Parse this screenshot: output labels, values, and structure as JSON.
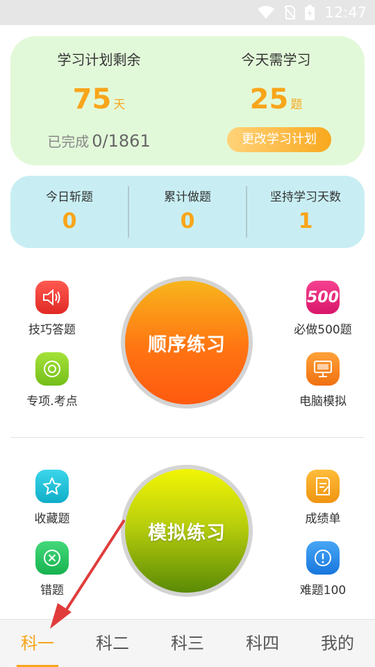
{
  "status_bar": {
    "time": "12:47",
    "icons": [
      "wifi-icon",
      "no-sim-icon",
      "battery-icon"
    ]
  },
  "plan": {
    "left_title": "学习计划剩余",
    "days_value": "75",
    "days_unit": "天",
    "completed_label": "已完成",
    "completed_value": "0/1861",
    "right_title": "今天需学习",
    "questions_value": "25",
    "questions_unit": "题",
    "change_button": "更改学习计划"
  },
  "stats": [
    {
      "label": "今日斩题",
      "value": "0"
    },
    {
      "label": "累计做题",
      "value": "0"
    },
    {
      "label": "坚持学习天数",
      "value": "1"
    }
  ],
  "practice_top": {
    "center_button": "顺序练习",
    "left": [
      {
        "label": "技巧答题",
        "icon": "speaker-icon",
        "color": "#f03a35"
      },
      {
        "label": "专项.考点",
        "icon": "target-icon",
        "color": "#8fd12a"
      }
    ],
    "right": [
      {
        "label": "必做500题",
        "icon": "badge-500-icon",
        "icon_text": "500",
        "color": "#e8247a"
      },
      {
        "label": "电脑模拟",
        "icon": "monitor-icon",
        "color": "#f7871c"
      }
    ]
  },
  "practice_bottom": {
    "center_button": "模拟练习",
    "left": [
      {
        "label": "收藏题",
        "icon": "star-icon",
        "color": "#19c3d9"
      },
      {
        "label": "错题",
        "icon": "close-circle-icon",
        "color": "#29c464"
      }
    ],
    "right": [
      {
        "label": "成绩单",
        "icon": "report-icon",
        "color": "#f5a21b"
      },
      {
        "label": "难题100",
        "icon": "alert-icon",
        "color": "#2a8fe8"
      }
    ]
  },
  "tabs": [
    "科一",
    "科二",
    "科三",
    "科四",
    "我的"
  ],
  "active_tab": "科一",
  "colors": {
    "accent": "#f8a51a",
    "plan_bg": "#e2f9d9",
    "stats_bg": "#c8eef3",
    "arrow": "#e03c3c"
  }
}
